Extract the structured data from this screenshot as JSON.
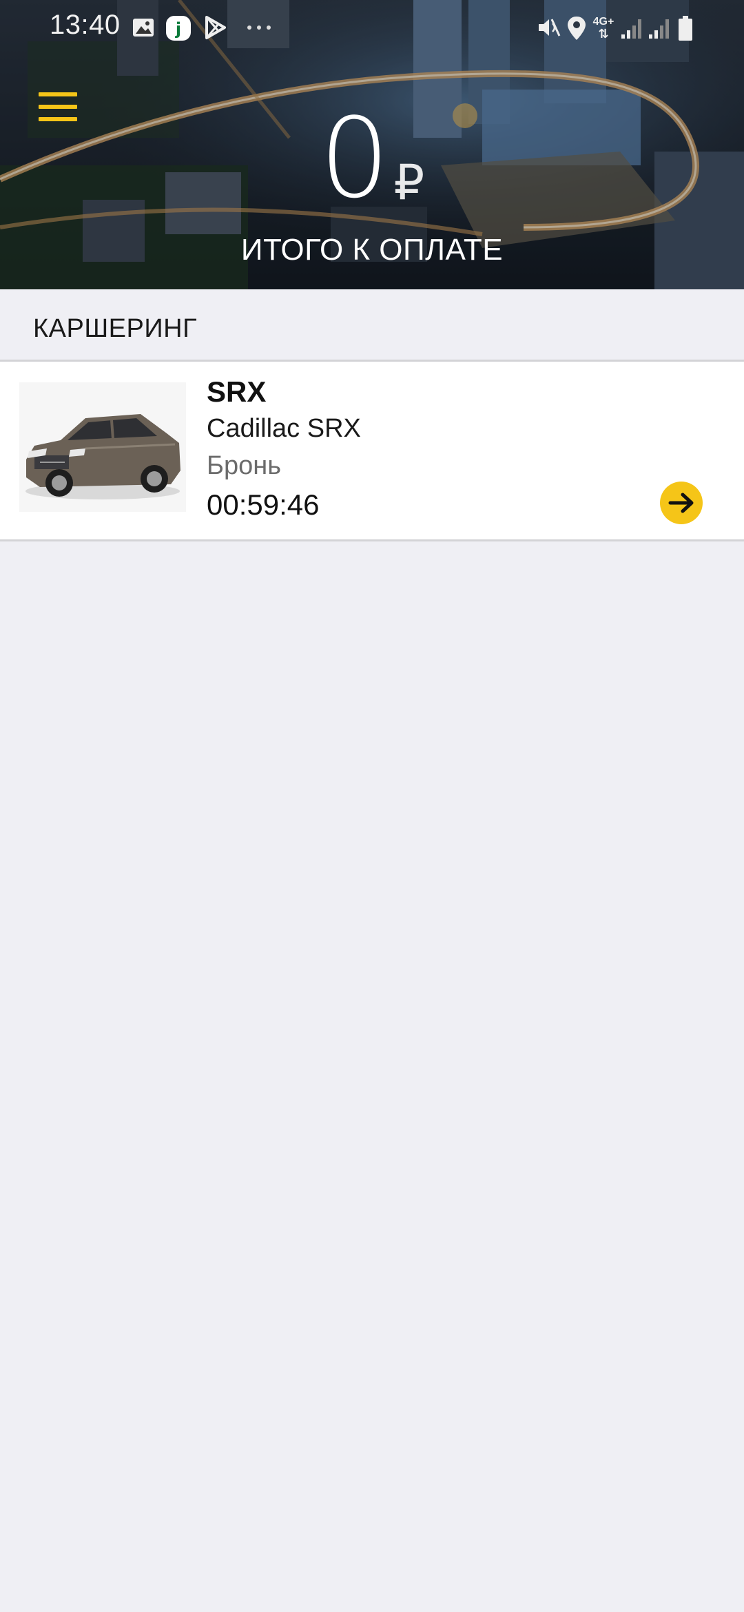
{
  "status_bar": {
    "time": "13:40",
    "left_icons": [
      "gallery-icon",
      "app-j-icon",
      "play-store-icon",
      "more-dots-icon"
    ],
    "right_icons": [
      "mute-icon",
      "location-icon",
      "network-4g-icon",
      "signal-icon",
      "signal-icon",
      "battery-icon"
    ],
    "network_label": "4G+"
  },
  "header": {
    "amount": "0",
    "currency": "₽",
    "total_label": "ИТОГО К ОПЛАТЕ",
    "menu_icon": "hamburger-menu-icon",
    "accent_color": "#f5c518"
  },
  "section": {
    "title": "КАРШЕРИНГ"
  },
  "booking": {
    "name": "SRX",
    "model": "Cadillac SRX",
    "status": "Бронь",
    "timer": "00:59:46",
    "action_icon": "arrow-right-icon"
  }
}
